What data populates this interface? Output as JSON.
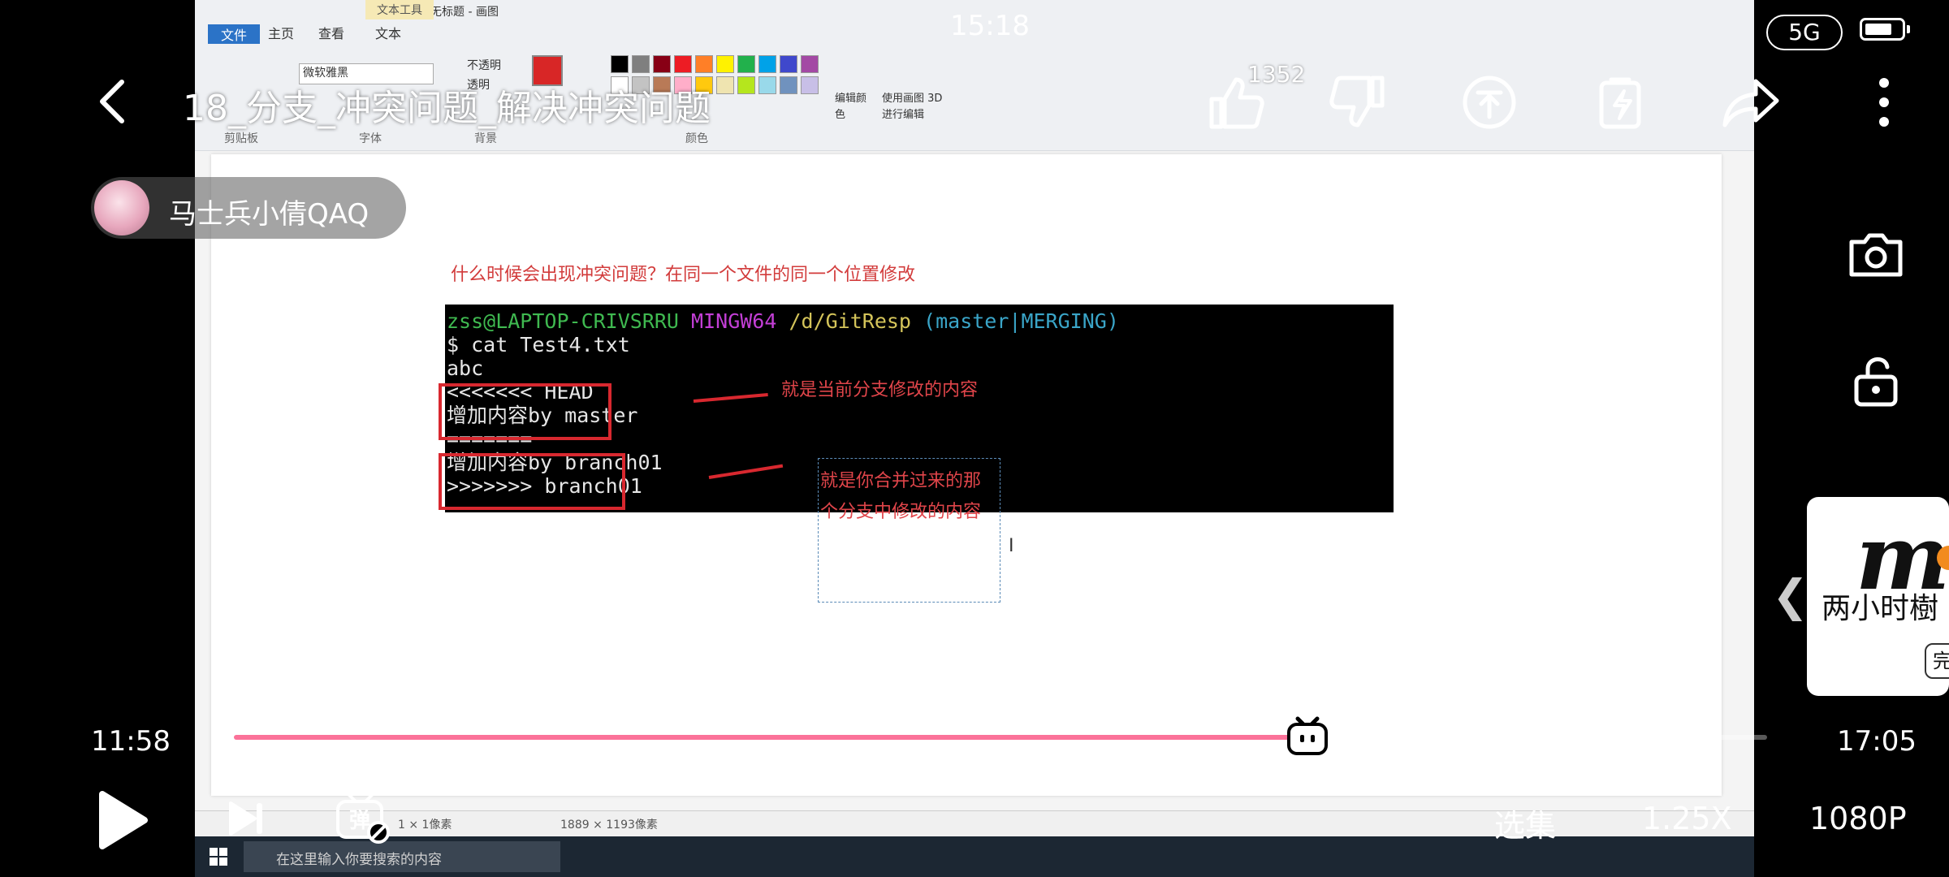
{
  "status_bar": {
    "time": "15:18",
    "network": "5G"
  },
  "header": {
    "title": "18_分支_冲突问题_解决冲突问题",
    "like_count": "1352"
  },
  "author": {
    "name": "马士兵小倩QAQ"
  },
  "video_frame": {
    "window_title": "无标题 - 画图",
    "ribbon_tabs": [
      "文件",
      "主页",
      "查看",
      "文本"
    ],
    "ribbon_context_tab": "文本工具",
    "font_name": "微软雅黑",
    "ribbon_groups": [
      "剪贴板",
      "字体",
      "背景",
      "颜色"
    ],
    "ribbon_buttons": [
      "编辑颜色",
      "使用画图 3D 进行编辑"
    ],
    "opacity_options": [
      "不透明",
      "透明"
    ],
    "question": "什么时候会出现冲突问题？在同一个文件的同一个位置修改",
    "terminal": {
      "prompt_user": "zss@LAPTOP-CRIVSRRU",
      "prompt_env": "MINGW64",
      "prompt_path": "/d/GitResp",
      "prompt_branch": "(master|MERGING)",
      "lines": [
        "$ cat Test4.txt",
        "abc",
        "<<<<<<< HEAD",
        "增加内容by master",
        "=======",
        "增加内容by branch01",
        ">>>>>>> branch01"
      ]
    },
    "annotation_current": "就是当前分支修改的内容",
    "annotation_merged_1": "就是你合并过来的那",
    "annotation_merged_2": "个分支中修改的内容",
    "status_selection": "1 × 1像素",
    "status_canvas_size": "1889 × 1193像素",
    "taskbar_search": "在这里输入你要搜索的内容"
  },
  "player": {
    "current_time": "11:58",
    "duration": "17:05",
    "played_fraction": 0.7,
    "buffered_fraction": 0.745,
    "episodes_label": "选集",
    "speed_label": "1.25X",
    "quality_label": "1080P"
  },
  "ad": {
    "big_text": "m",
    "text": "两小时樹",
    "button": "完"
  },
  "colors": {
    "accent": "#fb7299",
    "annotation_red": "#d8282f"
  }
}
